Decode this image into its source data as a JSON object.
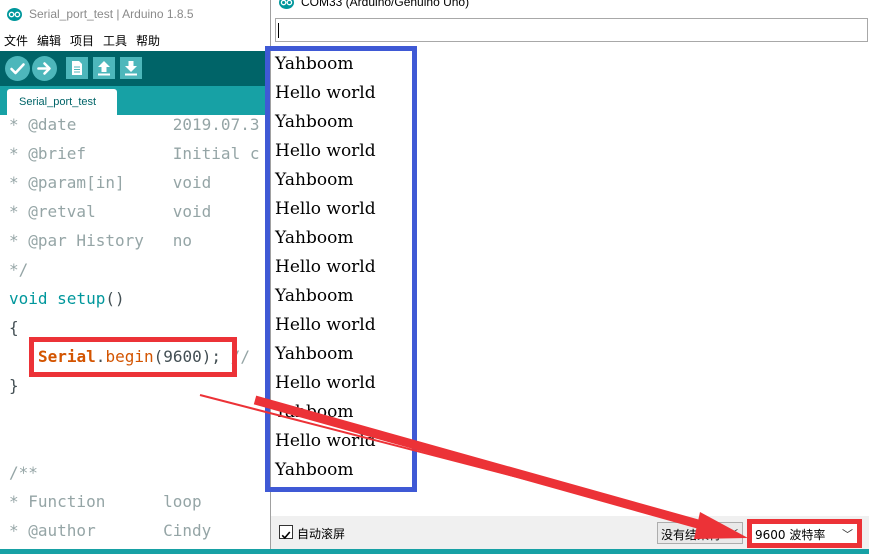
{
  "ide": {
    "title": "Serial_port_test | Arduino 1.8.5",
    "menu": [
      "文件",
      "编辑",
      "项目",
      "工具",
      "帮助"
    ],
    "toolbar": {
      "verify_icon": "check-icon",
      "upload_icon": "arrow-right-icon",
      "new_icon": "new-file-icon",
      "open_icon": "arrow-up-icon",
      "save_icon": "arrow-down-icon"
    },
    "tab_label": "Serial_port_test",
    "code_lines": [
      {
        "a": "* @date          ",
        "b": "2019.07.3"
      },
      {
        "a": "* @brief         ",
        "b": "Initial c"
      },
      {
        "a": "* @param[in]     ",
        "b": "void"
      },
      {
        "a": "* @retval        ",
        "b": "void"
      },
      {
        "a": "* @par History   ",
        "b": "no"
      },
      {
        "a": "*/",
        "b": ""
      }
    ],
    "setup_keyword": "void",
    "setup_name": "setup",
    "setup_parens": "()",
    "open_brace": "{",
    "serial_obj": "Serial",
    "serial_dot": ".",
    "serial_method": "begin",
    "serial_args": "(9600);",
    "serial_comment": " //",
    "close_brace": "}",
    "comment_open": "/**",
    "function_line": {
      "a": "* Function      ",
      "b": "loop"
    },
    "author_line": {
      "a": "* @author       ",
      "b": "Cindy"
    }
  },
  "serial_monitor": {
    "title": "COM33 (Arduino/Genuino Uno)",
    "input_value": "",
    "output_lines": [
      "Yahboom",
      "Hello world",
      "Yahboom",
      "Hello world",
      "Yahboom",
      "Hello world",
      "Yahboom",
      "Hello world",
      "Yahboom",
      "Hello world",
      "Yahboom",
      "Hello world",
      "Yahboom",
      "Hello world",
      "Yahboom"
    ],
    "autoscroll_label": "自动滚屏",
    "autoscroll_checked": true,
    "line_ending": "没有结束符",
    "baud_rate": "9600 波特率"
  },
  "colors": {
    "toolbar_dark": "#006468",
    "toolbar_button": "#4db7bb",
    "tab_strip": "#17a1a5",
    "highlight_red": "#ec3237",
    "highlight_blue": "#3f59d5"
  }
}
